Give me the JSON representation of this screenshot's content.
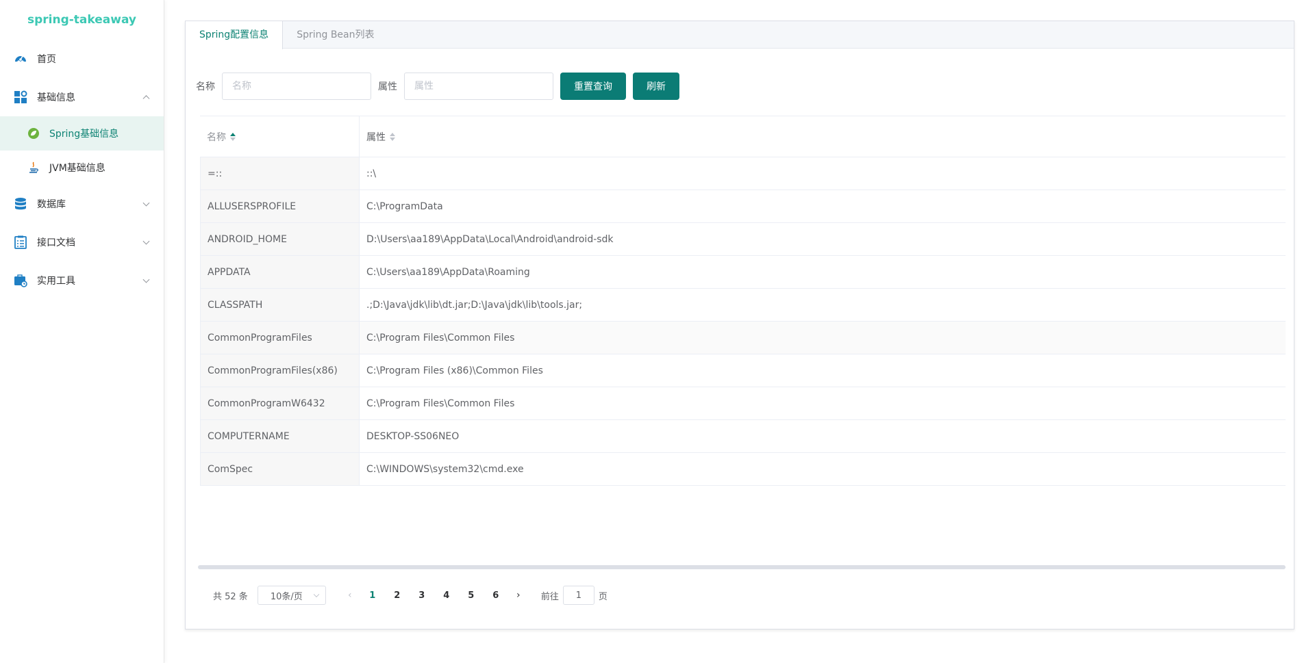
{
  "app": {
    "title": "spring-takeaway"
  },
  "sidebar": {
    "items": [
      {
        "label": "首页"
      },
      {
        "label": "基础信息"
      },
      {
        "label": "数据库"
      },
      {
        "label": "接口文档"
      },
      {
        "label": "实用工具"
      }
    ],
    "sub_items": [
      {
        "label": "Spring基础信息"
      },
      {
        "label": "JVM基础信息"
      }
    ]
  },
  "tabs": [
    {
      "label": "Spring配置信息"
    },
    {
      "label": "Spring Bean列表"
    }
  ],
  "filters": {
    "name_label": "名称",
    "name_placeholder": "名称",
    "attr_label": "属性",
    "attr_placeholder": "属性",
    "reset_label": "重置查询",
    "refresh_label": "刷新"
  },
  "table": {
    "headers": [
      "名称",
      "属性"
    ],
    "rows": [
      [
        "=::",
        "::\\"
      ],
      [
        "ALLUSERSPROFILE",
        "C:\\ProgramData"
      ],
      [
        "ANDROID_HOME",
        "D:\\Users\\aa189\\AppData\\Local\\Android\\android-sdk"
      ],
      [
        "APPDATA",
        "C:\\Users\\aa189\\AppData\\Roaming"
      ],
      [
        "CLASSPATH",
        ".;D:\\Java\\jdk\\lib\\dt.jar;D:\\Java\\jdk\\lib\\tools.jar;"
      ],
      [
        "CommonProgramFiles",
        "C:\\Program Files\\Common Files"
      ],
      [
        "CommonProgramFiles(x86)",
        "C:\\Program Files (x86)\\Common Files"
      ],
      [
        "CommonProgramW6432",
        "C:\\Program Files\\Common Files"
      ],
      [
        "COMPUTERNAME",
        "DESKTOP-SS06NEO"
      ],
      [
        "ComSpec",
        "C:\\WINDOWS\\system32\\cmd.exe"
      ]
    ]
  },
  "pagination": {
    "total": "共 52 条",
    "page_size": "10条/页",
    "pages": [
      "1",
      "2",
      "3",
      "4",
      "5",
      "6"
    ],
    "current": "1",
    "goto_label": "前往",
    "goto_value": "1",
    "page_suffix": "页"
  },
  "colors": {
    "accent": "#0b7c75",
    "logo": "#3cc8b4"
  }
}
